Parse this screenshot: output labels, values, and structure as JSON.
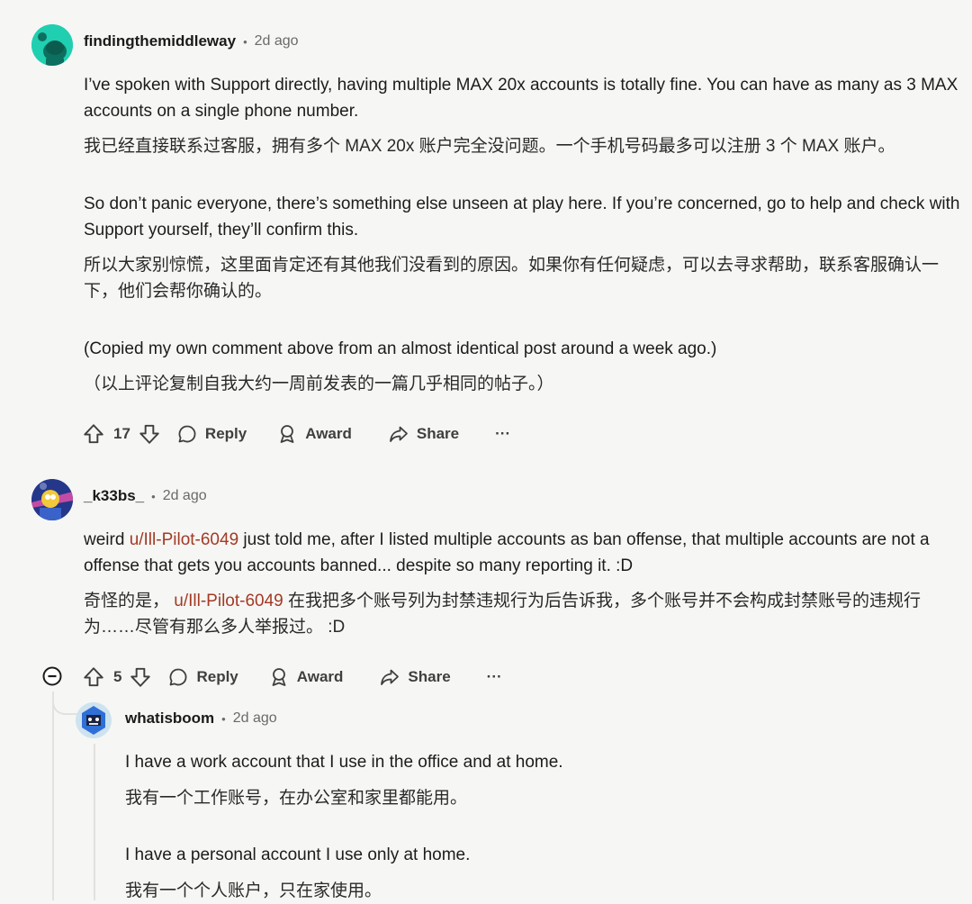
{
  "comments": [
    {
      "username": "findingthemiddleway",
      "time": "2d ago",
      "p1_en": "I’ve spoken with Support directly, having multiple MAX 20x accounts is totally fine. You can have as many as 3 MAX accounts on a single phone number.",
      "p1_zh": "我已经直接联系过客服，拥有多个 MAX 20x 账户完全没问题。一个手机号码最多可以注册 3 个 MAX 账户。",
      "p2_en": "So don’t panic everyone, there’s something else unseen at play here. If you’re concerned, go to help and check with Support yourself, they’ll confirm this.",
      "p2_zh": "所以大家别惊慌，这里面肯定还有其他我们没看到的原因。如果你有任何疑虑，可以去寻求帮助，联系客服确认一下，他们会帮你确认的。",
      "p3_en": "(Copied my own comment above from an almost identical post around a week ago.)",
      "p3_zh": "（以上评论复制自我大约一周前发表的一篇几乎相同的帖子。）",
      "votes": "17",
      "avatar_color": "#1fcfb0"
    },
    {
      "username": "_k33bs_",
      "time": "2d ago",
      "en_pre": "weird ",
      "mention": "u/Ill-Pilot-6049",
      "en_post": " just told me, after I listed multiple accounts as ban offense, that multiple accounts are not a offense that gets you accounts banned... despite so many reporting it. :D",
      "zh_pre": "奇怪的是， ",
      "zh_post": " 在我把多个账号列为封禁违规行为后告诉我，多个账号并不会构成封禁账号的违规行为……尽管有那么多人举报过。 :D",
      "votes": "5"
    },
    {
      "username": "whatisboom",
      "time": "2d ago",
      "p1_en": "I have a work account that I use in the office and at home.",
      "p1_zh": "我有一个工作账号，在办公室和家里都能用。",
      "p2_en": "I have a personal account I use only at home.",
      "p2_zh": "我有一个个人账户，只在家使用。"
    }
  ],
  "actions": {
    "reply": "Reply",
    "award": "Award",
    "share": "Share",
    "more": "···"
  },
  "separator": "•",
  "colors": {
    "mention": "#a33a25",
    "background": "#f6f6f4"
  }
}
